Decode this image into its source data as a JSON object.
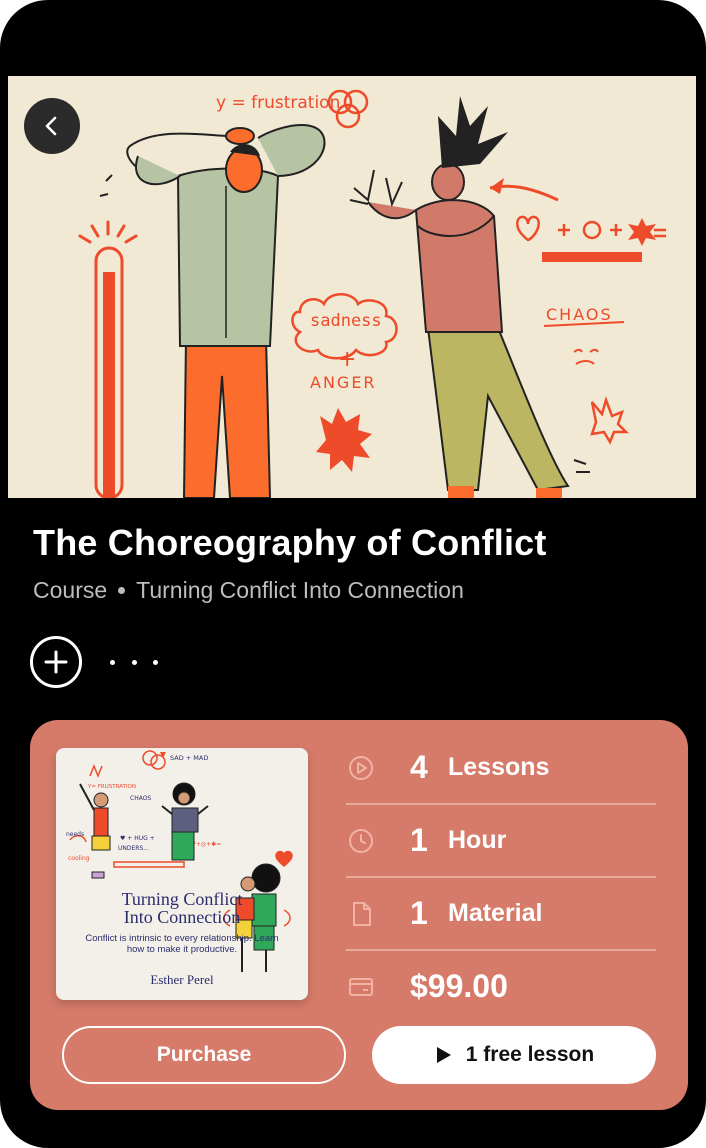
{
  "course": {
    "title": "The Choreography of Conflict",
    "type": "Course",
    "series": "Turning Conflict Into Connection"
  },
  "hero": {
    "labels": {
      "equation": "y = frustration",
      "sadness": "sadness",
      "plus": "+",
      "anger": "ANGER",
      "chaos": "CHAOS"
    }
  },
  "book": {
    "title_line1": "Turning Conflict",
    "title_line2": "Into Connection",
    "description": "Conflict is intrinsic to every relationship. Learn how to make it productive.",
    "author": "Esther Perel",
    "labels": {
      "sad_mad": "SAD + MAD",
      "frustration": "Y= FRUSTRATION",
      "chaos": "CHAOS",
      "needs": "needs",
      "cooling": "cooling",
      "hug": "♥ + HUG +",
      "understand": "UNDERS...",
      "formula": "♥²+◎+✱="
    }
  },
  "stats": {
    "lessons": {
      "number": "4",
      "label": "Lessons",
      "icon": "play-circle-icon"
    },
    "duration": {
      "number": "1",
      "label": "Hour",
      "icon": "clock-icon"
    },
    "materials": {
      "number": "1",
      "label": "Material",
      "icon": "document-icon"
    },
    "price": {
      "value": "$99.00",
      "icon": "credit-card-icon"
    }
  },
  "buttons": {
    "purchase": "Purchase",
    "free_lesson": "1 free lesson"
  },
  "colors": {
    "background": "#000000",
    "card": "#d67b6a",
    "hero_bg": "#f1e9d3",
    "accent_red": "#ee4b2b",
    "book_ink": "#2b2d6e"
  }
}
